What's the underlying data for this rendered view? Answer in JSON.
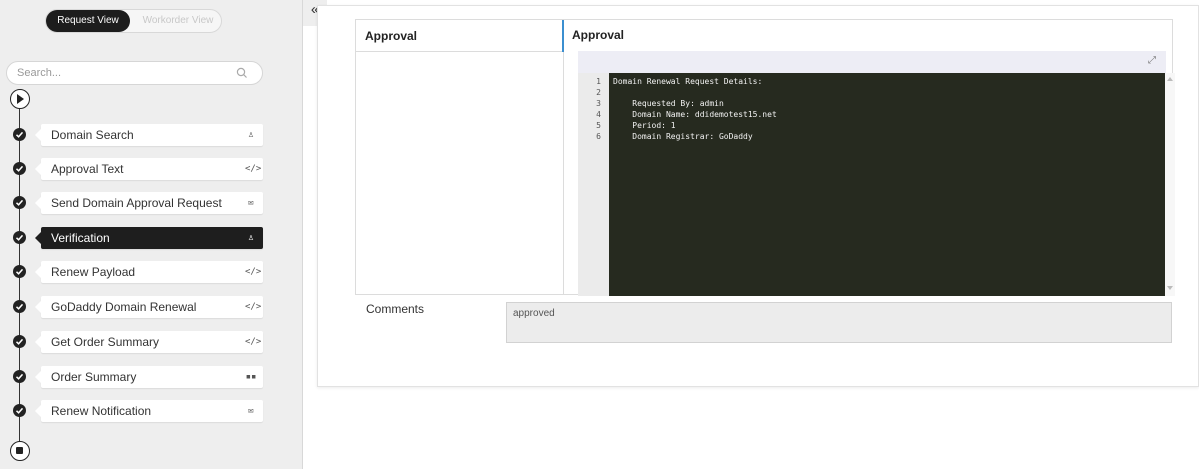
{
  "view_toggle": {
    "request_label": "Request View",
    "workorder_label": "Workorder View"
  },
  "search": {
    "placeholder": "Search..."
  },
  "steps": [
    {
      "label": "Domain Search",
      "icon": "person-icon",
      "glyph": "♙",
      "active": false
    },
    {
      "label": "Approval Text",
      "icon": "code-icon",
      "glyph": "</>",
      "active": false
    },
    {
      "label": "Send Domain Approval Request",
      "icon": "envelope-icon",
      "glyph": "✉",
      "active": false
    },
    {
      "label": "Verification",
      "icon": "person-icon",
      "glyph": "♙",
      "active": true
    },
    {
      "label": "Renew Payload",
      "icon": "code-icon",
      "glyph": "</>",
      "active": false
    },
    {
      "label": "GoDaddy Domain Renewal",
      "icon": "code-icon",
      "glyph": "</>",
      "active": false
    },
    {
      "label": "Get Order Summary",
      "icon": "code-icon",
      "glyph": "</>",
      "active": false
    },
    {
      "label": "Order Summary",
      "icon": "grid-icon",
      "glyph": "▪▪",
      "active": false
    },
    {
      "label": "Renew Notification",
      "icon": "envelope-icon",
      "glyph": "✉",
      "active": false
    }
  ],
  "collapse": {
    "glyph": "«"
  },
  "panel": {
    "left_title": "Approval",
    "right_title": "Approval"
  },
  "editor": {
    "line_numbers": [
      "1",
      "2",
      "3",
      "4",
      "5",
      "6"
    ],
    "lines": [
      "Domain Renewal Request Details:",
      "",
      "    Requested By: admin",
      "    Domain Name: ddidemotest15.net",
      "    Period: 1",
      "    Domain Registrar: GoDaddy"
    ]
  },
  "comments": {
    "label": "Comments",
    "value": "approved"
  },
  "colors": {
    "active_step": "#1e1e1e",
    "code_bg": "#262a1f",
    "accent": "#3b8fd0"
  }
}
